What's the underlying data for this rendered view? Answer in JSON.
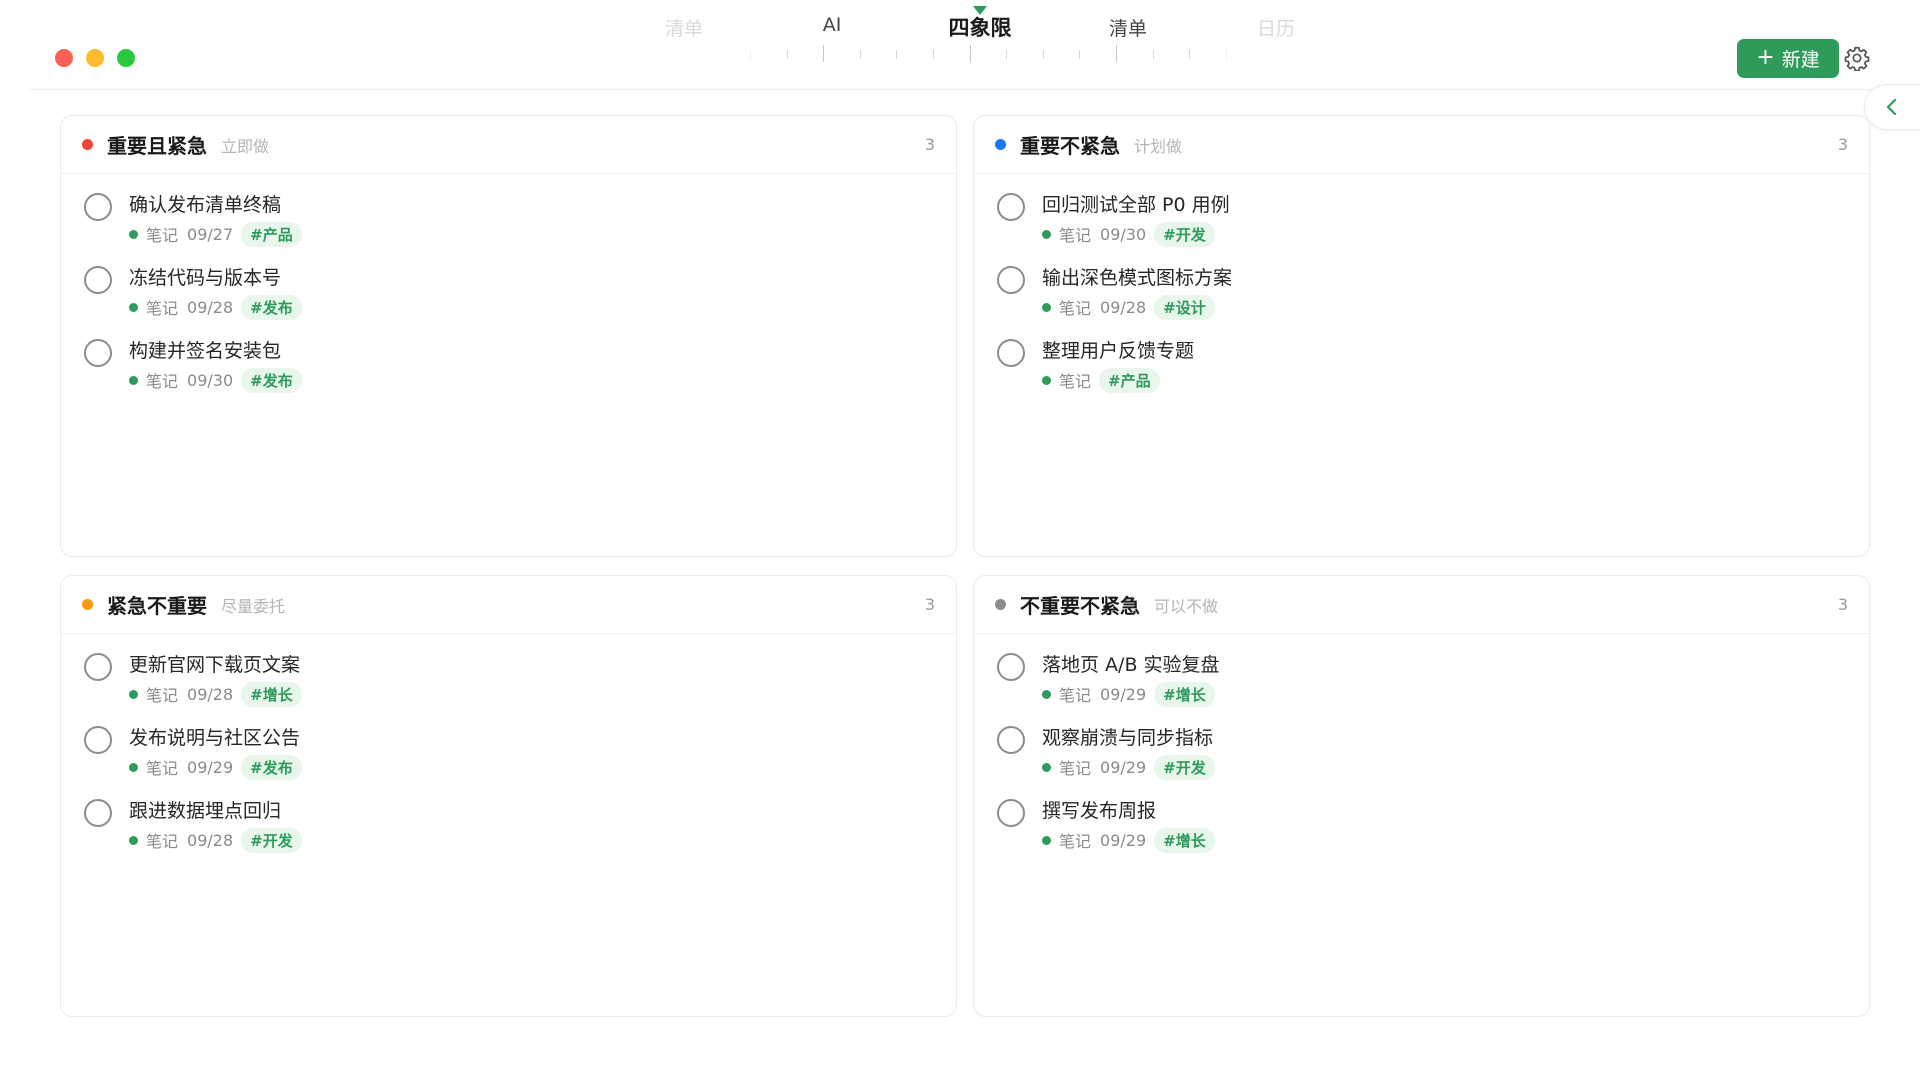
{
  "nav": {
    "tabs": [
      "清单",
      "AI",
      "四象限",
      "清单",
      "日历"
    ],
    "active": "四象限"
  },
  "toolbar": {
    "new_label": "新建",
    "new_icon": "plus-icon",
    "settings_icon": "gear-icon"
  },
  "colors": {
    "accent": "#2e9b5a",
    "red": "#f04438",
    "blue": "#1677ff",
    "orange": "#fa9a14",
    "gray": "#8c8c8c",
    "tag_bg": "#e8f6ec"
  },
  "quadrants": [
    {
      "title": "重要且紧急",
      "hint": "立即做",
      "count": "3",
      "tasks": [
        {
          "title": "确认发布清单终稿",
          "source": "笔记",
          "date": "09/27",
          "tag": "#产品"
        },
        {
          "title": "冻结代码与版本号",
          "source": "笔记",
          "date": "09/28",
          "tag": "#发布"
        },
        {
          "title": "构建并签名安装包",
          "source": "笔记",
          "date": "09/30",
          "tag": "#发布"
        }
      ]
    },
    {
      "title": "重要不紧急",
      "hint": "计划做",
      "count": "3",
      "tasks": [
        {
          "title": "回归测试全部 P0 用例",
          "source": "笔记",
          "date": "09/30",
          "tag": "#开发"
        },
        {
          "title": "输出深色模式图标方案",
          "source": "笔记",
          "date": "09/28",
          "tag": "#设计"
        },
        {
          "title": "整理用户反馈专题",
          "source": "笔记",
          "date": "",
          "tag": "#产品"
        }
      ]
    },
    {
      "title": "紧急不重要",
      "hint": "尽量委托",
      "count": "3",
      "tasks": [
        {
          "title": "更新官网下载页文案",
          "source": "笔记",
          "date": "09/28",
          "tag": "#增长"
        },
        {
          "title": "发布说明与社区公告",
          "source": "笔记",
          "date": "09/29",
          "tag": "#发布"
        },
        {
          "title": "跟进数据埋点回归",
          "source": "笔记",
          "date": "09/28",
          "tag": "#开发"
        }
      ]
    },
    {
      "title": "不重要不紧急",
      "hint": "可以不做",
      "count": "3",
      "tasks": [
        {
          "title": "落地页 A/B 实验复盘",
          "source": "笔记",
          "date": "09/29",
          "tag": "#增长"
        },
        {
          "title": "观察崩溃与同步指标",
          "source": "笔记",
          "date": "09/29",
          "tag": "#开发"
        },
        {
          "title": "撰写发布周报",
          "source": "笔记",
          "date": "09/29",
          "tag": "#增长"
        }
      ]
    }
  ]
}
